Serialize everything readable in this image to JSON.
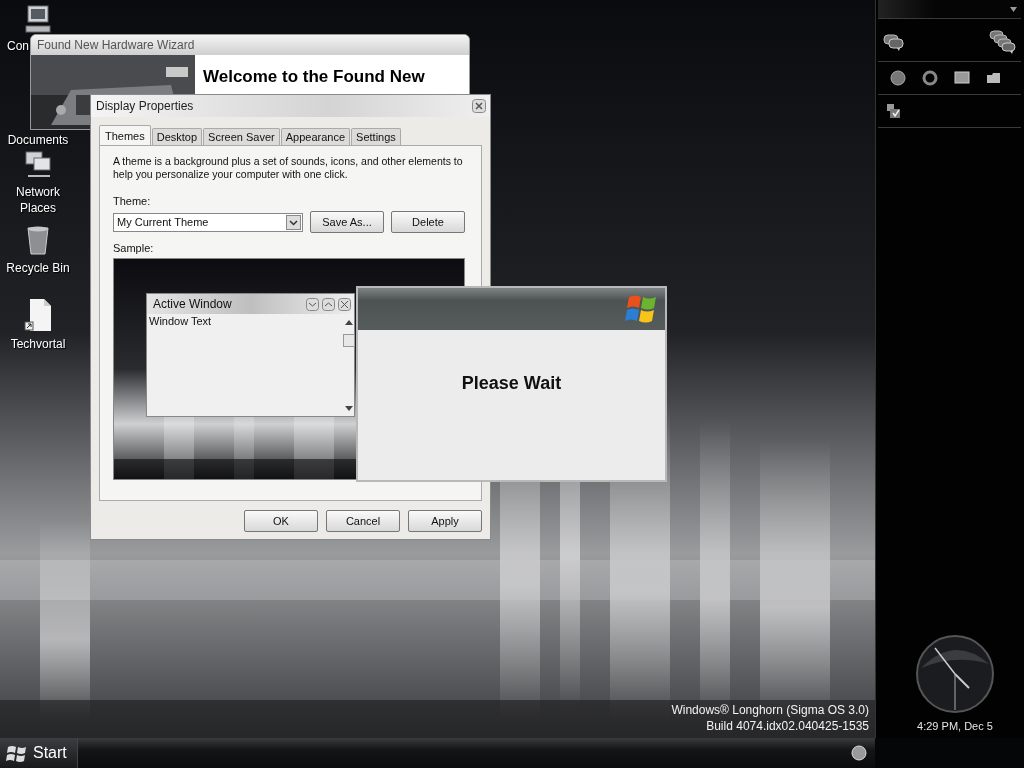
{
  "desktop_icons": [
    {
      "kind": "computer",
      "label": "Con"
    },
    {
      "kind": "documents",
      "label": "Documents"
    },
    {
      "kind": "network",
      "label": "Network Places"
    },
    {
      "kind": "recycle_bin",
      "label": "Recycle Bin"
    },
    {
      "kind": "shortcut",
      "label": "Techvortal"
    }
  ],
  "wizard": {
    "title": "Found New Hardware Wizard",
    "heading": "Welcome to the Found New"
  },
  "display_properties": {
    "title": "Display Properties",
    "tabs": [
      {
        "label": "Themes",
        "selected": true
      },
      {
        "label": "Desktop",
        "selected": false
      },
      {
        "label": "Screen Saver",
        "selected": false
      },
      {
        "label": "Appearance",
        "selected": false
      },
      {
        "label": "Settings",
        "selected": false
      }
    ],
    "description": "A theme is a background plus a set of sounds, icons, and other elements to help you personalize your computer with one click.",
    "theme_label": "Theme:",
    "theme_value": "My Current Theme",
    "theme_buttons": [
      "Save As...",
      "Delete"
    ],
    "sample_label": "Sample:",
    "sample": {
      "window_title": "Active Window",
      "window_text": "Window Text"
    },
    "footer_buttons": [
      "OK",
      "Cancel",
      "Apply"
    ]
  },
  "please_wait": {
    "message": "Please Wait"
  },
  "version_text": [
    "Windows® Longhorn (Sigma OS 3.0)",
    "Build 4074.idx02.040425-1535"
  ],
  "taskbar": {
    "start_label": "Start"
  },
  "sidebar": {
    "clock_text": "4:29 PM, Dec 5"
  }
}
